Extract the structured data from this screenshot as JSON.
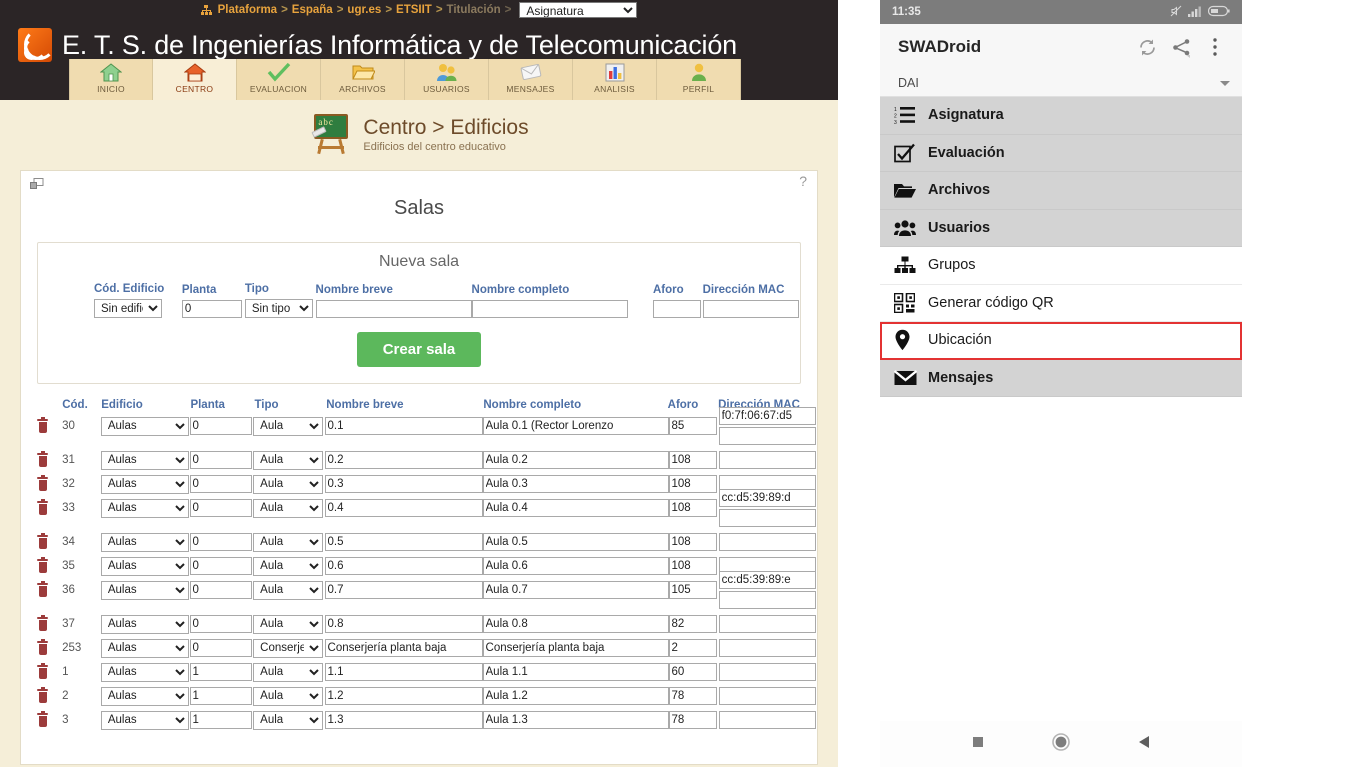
{
  "web": {
    "breadcrumb": {
      "icon": "sitemap-icon",
      "items": [
        {
          "label": "Plataforma",
          "dim": false
        },
        {
          "label": "España",
          "dim": false
        },
        {
          "label": "ugr.es",
          "dim": false
        },
        {
          "label": "ETSIIT",
          "dim": false
        },
        {
          "label": "Titulación",
          "dim": true
        }
      ],
      "separator": ">",
      "select_value": "Asignatura",
      "select_options": [
        "Asignatura"
      ]
    },
    "brand": {
      "title": "E. T. S. de Ingenierías Informática y de Telecomunicación",
      "logo_icon": "swad-rss-logo"
    },
    "tabs": [
      {
        "label": "INICIO",
        "icon": "home-icon",
        "selected": false
      },
      {
        "label": "CENTRO",
        "icon": "building-icon",
        "selected": true
      },
      {
        "label": "EVALUACION",
        "icon": "check-icon",
        "selected": false
      },
      {
        "label": "ARCHIVOS",
        "icon": "folder-icon",
        "selected": false
      },
      {
        "label": "USUARIOS",
        "icon": "users-icon",
        "selected": false
      },
      {
        "label": "MENSAJES",
        "icon": "envelope-icon",
        "selected": false
      },
      {
        "label": "ANALISIS",
        "icon": "chart-icon",
        "selected": false
      },
      {
        "label": "PERFIL",
        "icon": "person-icon",
        "selected": false
      }
    ],
    "section": {
      "icon": "blackboard-icon",
      "board_text": "abc",
      "title": "Centro > Edificios",
      "subtitle": "Edificios del centro educativo"
    },
    "card": {
      "pin_icon": "pin-window-icon",
      "help_label": "?",
      "title": "Salas"
    },
    "new_room": {
      "title": "Nueva sala",
      "headers": [
        "Cód.",
        "Edificio",
        "Planta",
        "Tipo",
        "Nombre breve",
        "Nombre completo",
        "Aforo",
        "Dirección MAC"
      ],
      "edificio_value": "Sin edificio",
      "planta_value": "0",
      "tipo_value": "Sin tipo",
      "nombre_breve_value": "",
      "nombre_completo_value": "",
      "aforo_value": "",
      "mac_value": "",
      "submit_label": "Crear sala",
      "submit_color": "#5cb85c"
    },
    "table": {
      "headers": {
        "cod": "Cód.",
        "edificio": "Edificio",
        "planta": "Planta",
        "tipo": "Tipo",
        "breve": "Nombre breve",
        "completo": "Nombre completo",
        "aforo": "Aforo",
        "mac": "Dirección MAC"
      },
      "rows": [
        {
          "cod": "30",
          "edificio": "Aulas",
          "planta": "0",
          "tipo": "Aula",
          "breve": "0.1",
          "completo": "Aula 0.1 (Rector Lorenzo",
          "aforo": "85",
          "mac": "f0:7f:06:67:d5",
          "mac_extra": true,
          "gap_after": true
        },
        {
          "cod": "31",
          "edificio": "Aulas",
          "planta": "0",
          "tipo": "Aula",
          "breve": "0.2",
          "completo": "Aula 0.2",
          "aforo": "108",
          "mac": "",
          "mac_extra": false,
          "gap_after": false
        },
        {
          "cod": "32",
          "edificio": "Aulas",
          "planta": "0",
          "tipo": "Aula",
          "breve": "0.3",
          "completo": "Aula 0.3",
          "aforo": "108",
          "mac": "",
          "mac_extra": false,
          "gap_after": false
        },
        {
          "cod": "33",
          "edificio": "Aulas",
          "planta": "0",
          "tipo": "Aula",
          "breve": "0.4",
          "completo": "Aula 0.4",
          "aforo": "108",
          "mac": "cc:d5:39:89:d",
          "mac_extra": true,
          "gap_after": true
        },
        {
          "cod": "34",
          "edificio": "Aulas",
          "planta": "0",
          "tipo": "Aula",
          "breve": "0.5",
          "completo": "Aula 0.5",
          "aforo": "108",
          "mac": "",
          "mac_extra": false,
          "gap_after": false
        },
        {
          "cod": "35",
          "edificio": "Aulas",
          "planta": "0",
          "tipo": "Aula",
          "breve": "0.6",
          "completo": "Aula 0.6",
          "aforo": "108",
          "mac": "",
          "mac_extra": false,
          "gap_after": false
        },
        {
          "cod": "36",
          "edificio": "Aulas",
          "planta": "0",
          "tipo": "Aula",
          "breve": "0.7",
          "completo": "Aula 0.7",
          "aforo": "105",
          "mac": "cc:d5:39:89:e",
          "mac_extra": true,
          "gap_after": true
        },
        {
          "cod": "37",
          "edificio": "Aulas",
          "planta": "0",
          "tipo": "Aula",
          "breve": "0.8",
          "completo": "Aula 0.8",
          "aforo": "82",
          "mac": "",
          "mac_extra": false,
          "gap_after": false
        },
        {
          "cod": "253",
          "edificio": "Aulas",
          "planta": "0",
          "tipo": "Conserjería",
          "breve": "Conserjería planta baja",
          "completo": "Conserjería planta baja",
          "aforo": "2",
          "mac": "",
          "mac_extra": false,
          "gap_after": false
        },
        {
          "cod": "1",
          "edificio": "Aulas",
          "planta": "1",
          "tipo": "Aula",
          "breve": "1.1",
          "completo": "Aula 1.1",
          "aforo": "60",
          "mac": "",
          "mac_extra": false,
          "gap_after": false
        },
        {
          "cod": "2",
          "edificio": "Aulas",
          "planta": "1",
          "tipo": "Aula",
          "breve": "1.2",
          "completo": "Aula 1.2",
          "aforo": "78",
          "mac": "",
          "mac_extra": false,
          "gap_after": false
        },
        {
          "cod": "3",
          "edificio": "Aulas",
          "planta": "1",
          "tipo": "Aula",
          "breve": "1.3",
          "completo": "Aula 1.3",
          "aforo": "78",
          "mac": "",
          "mac_extra": false,
          "gap_after": false
        }
      ],
      "delete_icon": "trash-icon"
    }
  },
  "phone": {
    "status": {
      "time": "11:35",
      "icons": [
        "mute-icon",
        "signal-icon",
        "battery-icon"
      ]
    },
    "appbar": {
      "title": "SWADroid",
      "actions": [
        {
          "icon": "refresh-icon",
          "name": "refresh-button"
        },
        {
          "icon": "share-icon",
          "name": "share-button"
        },
        {
          "icon": "overflow-menu-icon",
          "name": "overflow-menu-button"
        }
      ]
    },
    "spinner": {
      "value": "DAI",
      "caret_icon": "chevron-down-icon"
    },
    "menu": [
      {
        "label": "Asignatura",
        "icon": "numbered-list-icon",
        "shaded": true,
        "highlighted": false
      },
      {
        "label": "Evaluación",
        "icon": "checkbox-icon",
        "shaded": true,
        "highlighted": false
      },
      {
        "label": "Archivos",
        "icon": "folder-open-icon",
        "shaded": true,
        "highlighted": false
      },
      {
        "label": "Usuarios",
        "icon": "users-group-icon",
        "shaded": true,
        "highlighted": false
      },
      {
        "label": "Grupos",
        "icon": "sitemap-icon",
        "shaded": false,
        "highlighted": false
      },
      {
        "label": "Generar código QR",
        "icon": "qr-code-icon",
        "shaded": false,
        "highlighted": false
      },
      {
        "label": "Ubicación",
        "icon": "location-pin-icon",
        "shaded": false,
        "highlighted": true
      },
      {
        "label": "Mensajes",
        "icon": "envelope-icon",
        "shaded": true,
        "highlighted": false
      }
    ],
    "highlight_color": "#e33232",
    "navbar": [
      {
        "icon": "recents-square-icon",
        "name": "recents-button"
      },
      {
        "icon": "home-circle-icon",
        "name": "home-button"
      },
      {
        "icon": "back-triangle-icon",
        "name": "back-button"
      }
    ]
  }
}
